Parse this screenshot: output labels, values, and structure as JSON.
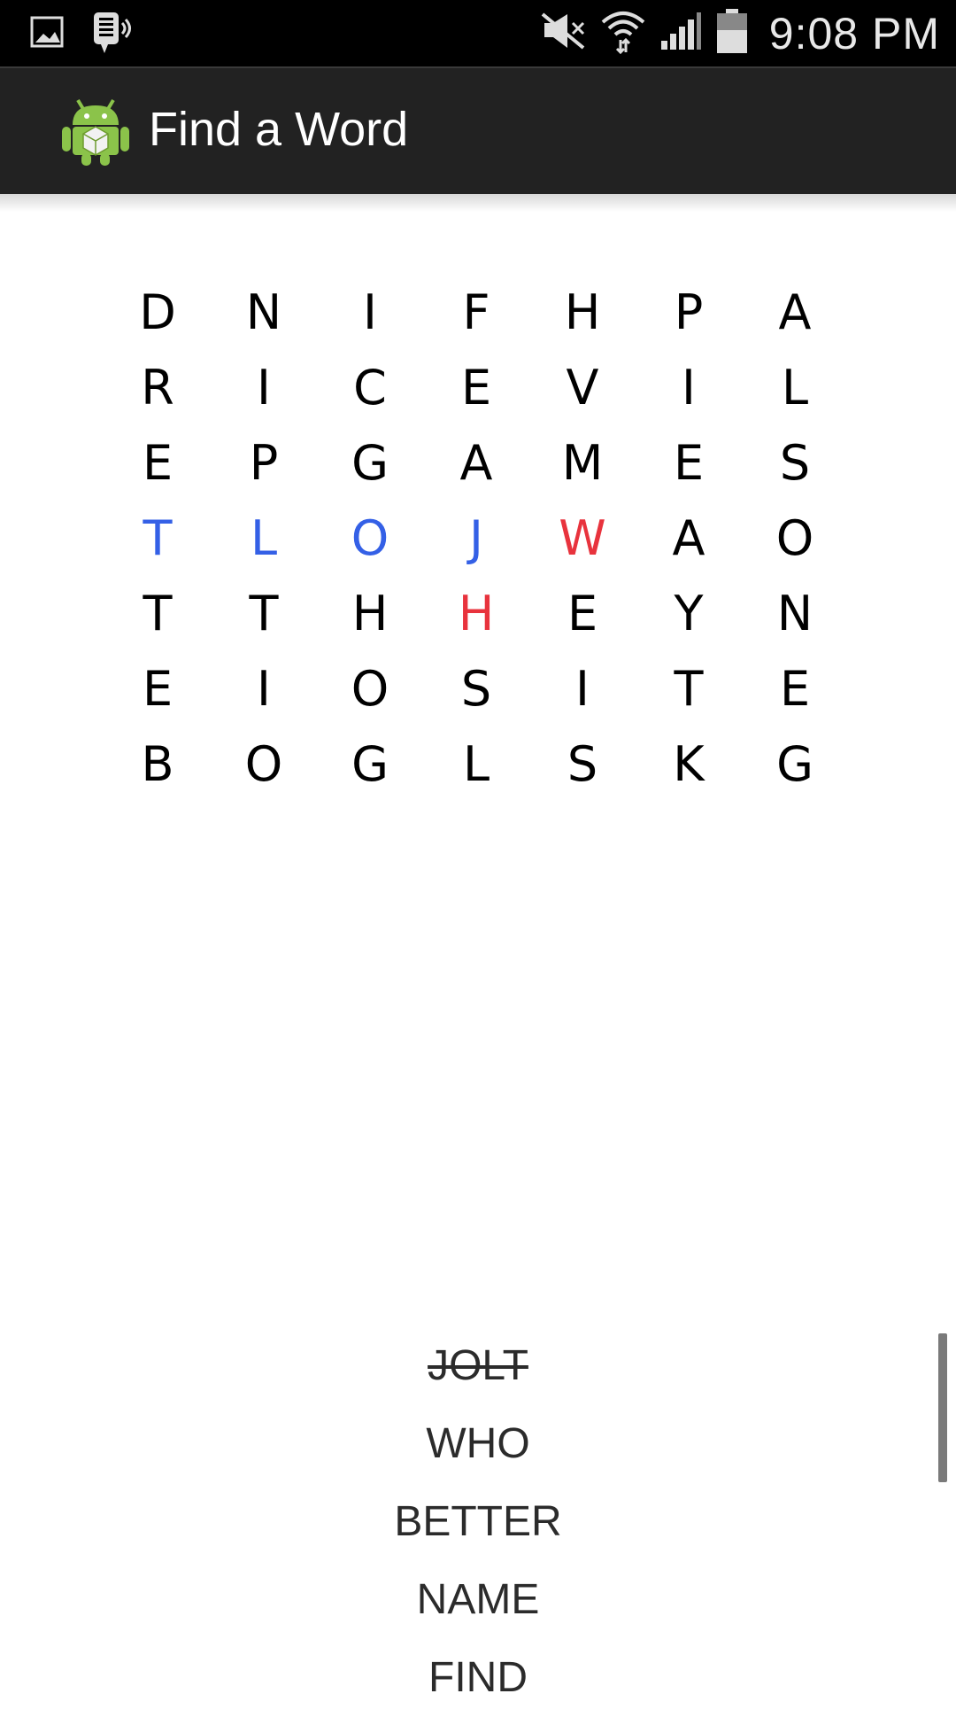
{
  "status_bar": {
    "time": "9:08 PM",
    "icons": [
      "gallery-icon",
      "voicemail-icon",
      "mute-icon",
      "wifi-icon",
      "signal-icon",
      "battery-icon"
    ]
  },
  "action_bar": {
    "title": "Find a Word",
    "icon": "android-app-icon"
  },
  "grid": {
    "rows": [
      [
        "D",
        "N",
        "I",
        "F",
        "H",
        "P",
        "A"
      ],
      [
        "R",
        "I",
        "C",
        "E",
        "V",
        "I",
        "L"
      ],
      [
        "E",
        "P",
        "G",
        "A",
        "M",
        "E",
        "S"
      ],
      [
        "T",
        "L",
        "O",
        "J",
        "W",
        "A",
        "O"
      ],
      [
        "T",
        "T",
        "H",
        "H",
        "E",
        "Y",
        "N"
      ],
      [
        "E",
        "I",
        "O",
        "S",
        "I",
        "T",
        "E"
      ],
      [
        "B",
        "O",
        "G",
        "L",
        "S",
        "K",
        "G"
      ]
    ],
    "found_cells": [
      [
        3,
        0
      ],
      [
        3,
        1
      ],
      [
        3,
        2
      ],
      [
        3,
        3
      ]
    ],
    "selected_cells": [
      [
        3,
        4
      ],
      [
        4,
        3
      ]
    ],
    "colors": {
      "found": "#3460e6",
      "selected": "#e8333d",
      "default": "#000000"
    }
  },
  "words": [
    {
      "label": "JOLT",
      "found": true
    },
    {
      "label": "WHO",
      "found": false
    },
    {
      "label": "BETTER",
      "found": false
    },
    {
      "label": "NAME",
      "found": false
    },
    {
      "label": "FIND",
      "found": false
    }
  ]
}
